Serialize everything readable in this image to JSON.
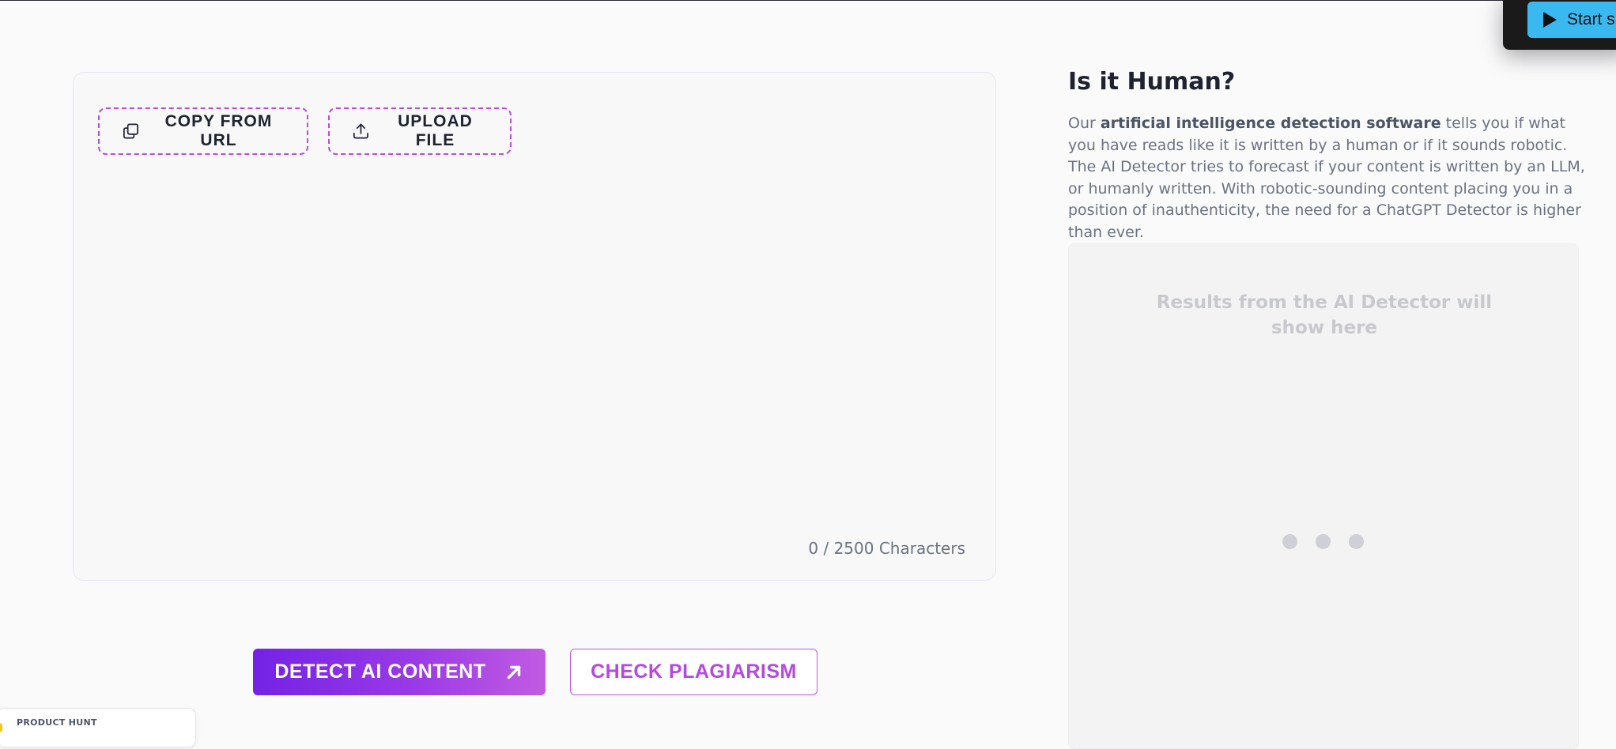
{
  "editor": {
    "copy_url_label": "COPY FROM URL",
    "upload_file_label": "UPLOAD FILE",
    "char_count": "0",
    "char_max": "2500",
    "char_suffix": "Characters"
  },
  "actions": {
    "detect_label": "DETECT AI CONTENT",
    "plagiarism_label": "CHECK PLAGIARISM"
  },
  "info": {
    "heading": "Is it Human?",
    "desc_prefix": "Our ",
    "desc_bold": "artificial intelligence detection software",
    "desc_rest": " tells you if what you have reads like it is written by a human or if it sounds robotic. The AI Detector tries to forecast if your content is written by an LLM, or humanly written. With robotic-sounding content placing you in a position of inauthenticity, the need for a ChatGPT Detector is higher than ever."
  },
  "results": {
    "placeholder": "Results from the AI Detector will show here"
  },
  "widget": {
    "button_label": "Start s"
  },
  "product_hunt": {
    "label": "PRODUCT HUNT"
  },
  "colors": {
    "accent_purple": "#7322e6",
    "accent_pink": "#c15be3",
    "widget_blue": "#3ab8f0"
  },
  "icons": {
    "copy": "copy-icon",
    "upload": "upload-icon",
    "arrow": "arrow-up-right-icon",
    "play": "play-icon"
  }
}
